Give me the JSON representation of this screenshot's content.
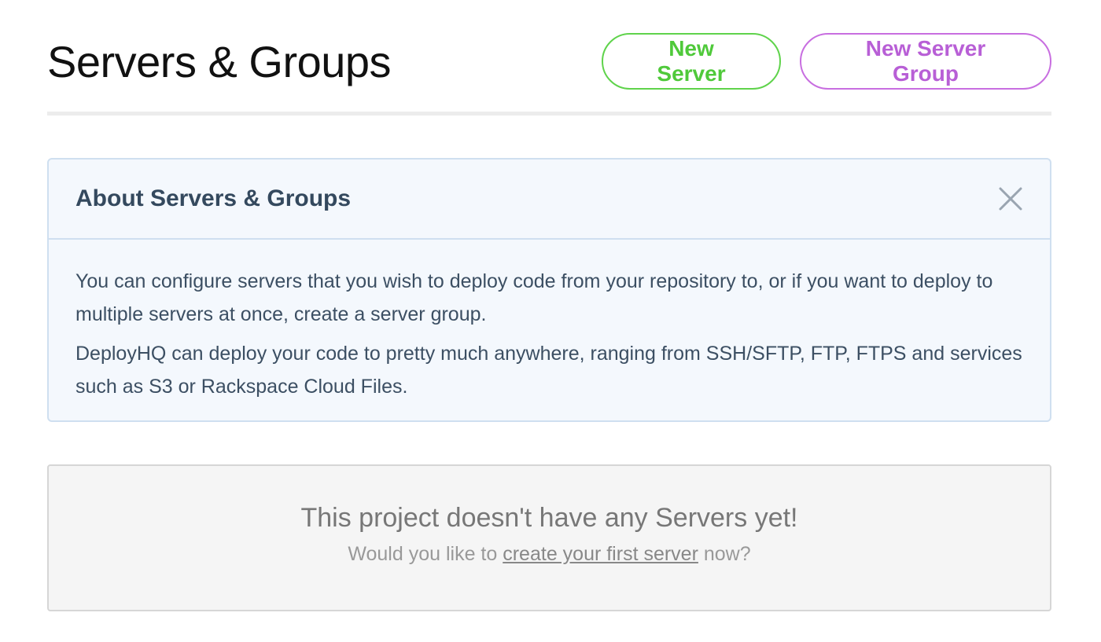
{
  "header": {
    "title": "Servers & Groups",
    "new_server_label": "New Server",
    "new_group_label": "New Server Group"
  },
  "info": {
    "title": "About Servers & Groups",
    "close_icon": "close-icon",
    "paragraph_1": "You can configure servers that you wish to deploy code from your repository to, or if you want to deploy to multiple servers at once, create a server group.",
    "paragraph_2": "DeployHQ can deploy your code to pretty much anywhere, ranging from SSH/SFTP, FTP, FTPS and services such as S3 or Rackspace Cloud Files."
  },
  "empty_state": {
    "title": "This project doesn't have any Servers yet!",
    "prefix": "Would you like to ",
    "link_text": "create your first server",
    "suffix": " now?"
  },
  "colors": {
    "green_accent": "#4fc93a",
    "purple_accent": "#b85fd6",
    "info_bg": "#f4f8fd",
    "info_border": "#cfdff0"
  }
}
